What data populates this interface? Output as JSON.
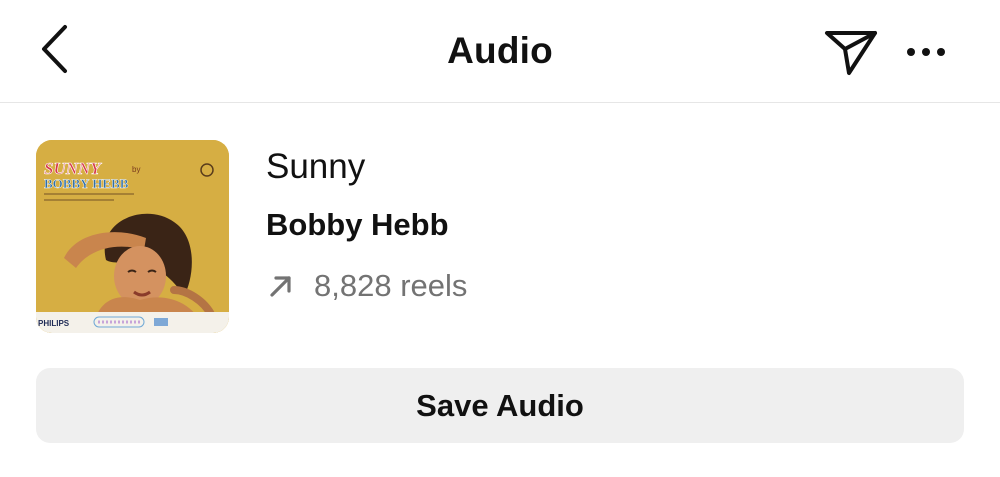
{
  "header": {
    "title": "Audio",
    "back_icon": "chevron-left-icon",
    "share_icon": "paper-plane-icon",
    "more_icon": "more-horizontal-icon"
  },
  "track": {
    "title": "Sunny",
    "artist": "Bobby Hebb",
    "reels_count": "8,828 reels",
    "trend_icon": "arrow-up-right-icon",
    "cover": {
      "title": "SUNNY",
      "by": "by",
      "artist": "BOBBY HEBB",
      "label": "PHILIPS",
      "background_color": "#d6ae43"
    }
  },
  "actions": {
    "save_label": "Save Audio"
  },
  "colors": {
    "text": "#111111",
    "secondary_text": "#737373",
    "button_bg": "#efefef",
    "divider": "#e6e6e6"
  }
}
